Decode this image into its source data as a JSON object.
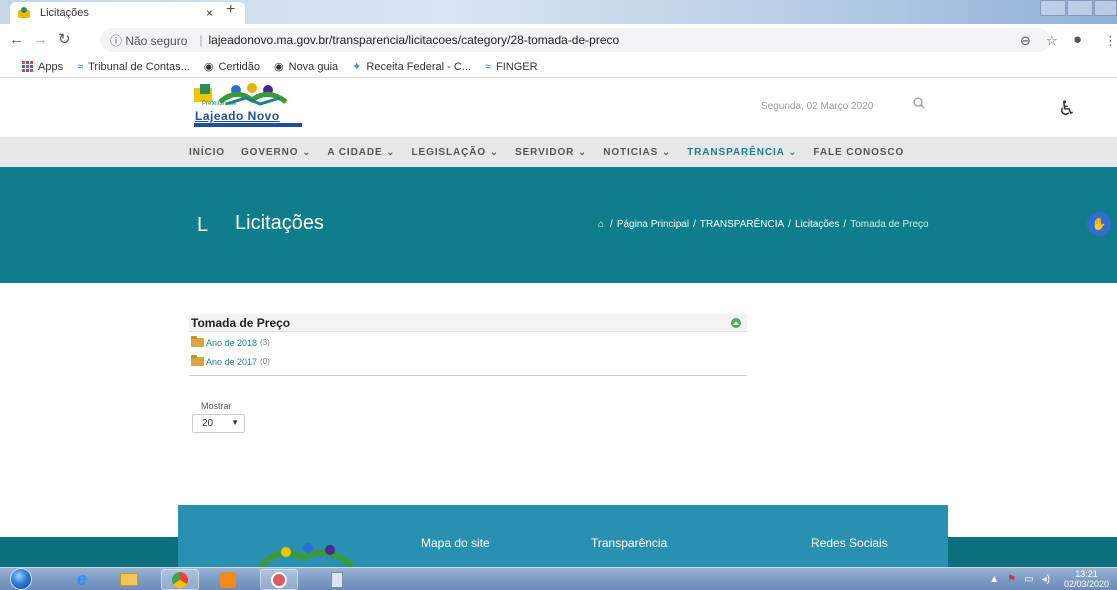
{
  "browser": {
    "tab_title": "Licitações",
    "tab_close": "×",
    "new_tab": "+",
    "url_info": "ⓘ Não seguro",
    "url_separator": "|",
    "url": "lajeadonovo.ma.gov.br/transparencia/licitacoes/category/28-tomada-de-preco",
    "bookmarks": [
      {
        "label": "Apps"
      },
      {
        "label": "Tribunal de Contas..."
      },
      {
        "label": "Certidão"
      },
      {
        "label": "Nova guia"
      },
      {
        "label": "Receita Federal - C..."
      },
      {
        "label": "FINGER"
      }
    ]
  },
  "header": {
    "logo_small": "Prefeitura de",
    "logo_text": "Lajeado Novo",
    "date": "Segunda, 02 Março 2020"
  },
  "menu": [
    {
      "label": "INÍCIO"
    },
    {
      "label": "GOVERNO ⌄"
    },
    {
      "label": "A CIDADE ⌄"
    },
    {
      "label": "LEGISLAÇÃO ⌄"
    },
    {
      "label": "SERVIDOR ⌄"
    },
    {
      "label": "NOTICIAS ⌄"
    },
    {
      "label": "TRANSPARÊNCIA ⌄",
      "active": true
    },
    {
      "label": "FALE CONOSCO"
    }
  ],
  "banner": {
    "letter": "L",
    "title": "Licitações",
    "breadcrumb": [
      "Página Principal",
      "TRANSPARÊNCIA",
      "Licitações",
      "Tomada de Preço"
    ]
  },
  "category": {
    "title": "Tomada de Preço",
    "items": [
      {
        "label": "Ano de 2018",
        "count": "(3)"
      },
      {
        "label": "Ano de 2017",
        "count": "(0)"
      }
    ]
  },
  "list_controls": {
    "show_label": "Mostrar",
    "show_value": "20"
  },
  "footer": {
    "links": [
      "Mapa do site",
      "Transparência",
      "Redes Sociais"
    ]
  },
  "taskbar": {
    "time": "13:21",
    "date": "02/03/2020"
  },
  "colors": {
    "teal": "#0e7d8c",
    "footer_blue": "#2a90b1",
    "link": "#1b7f8f"
  }
}
